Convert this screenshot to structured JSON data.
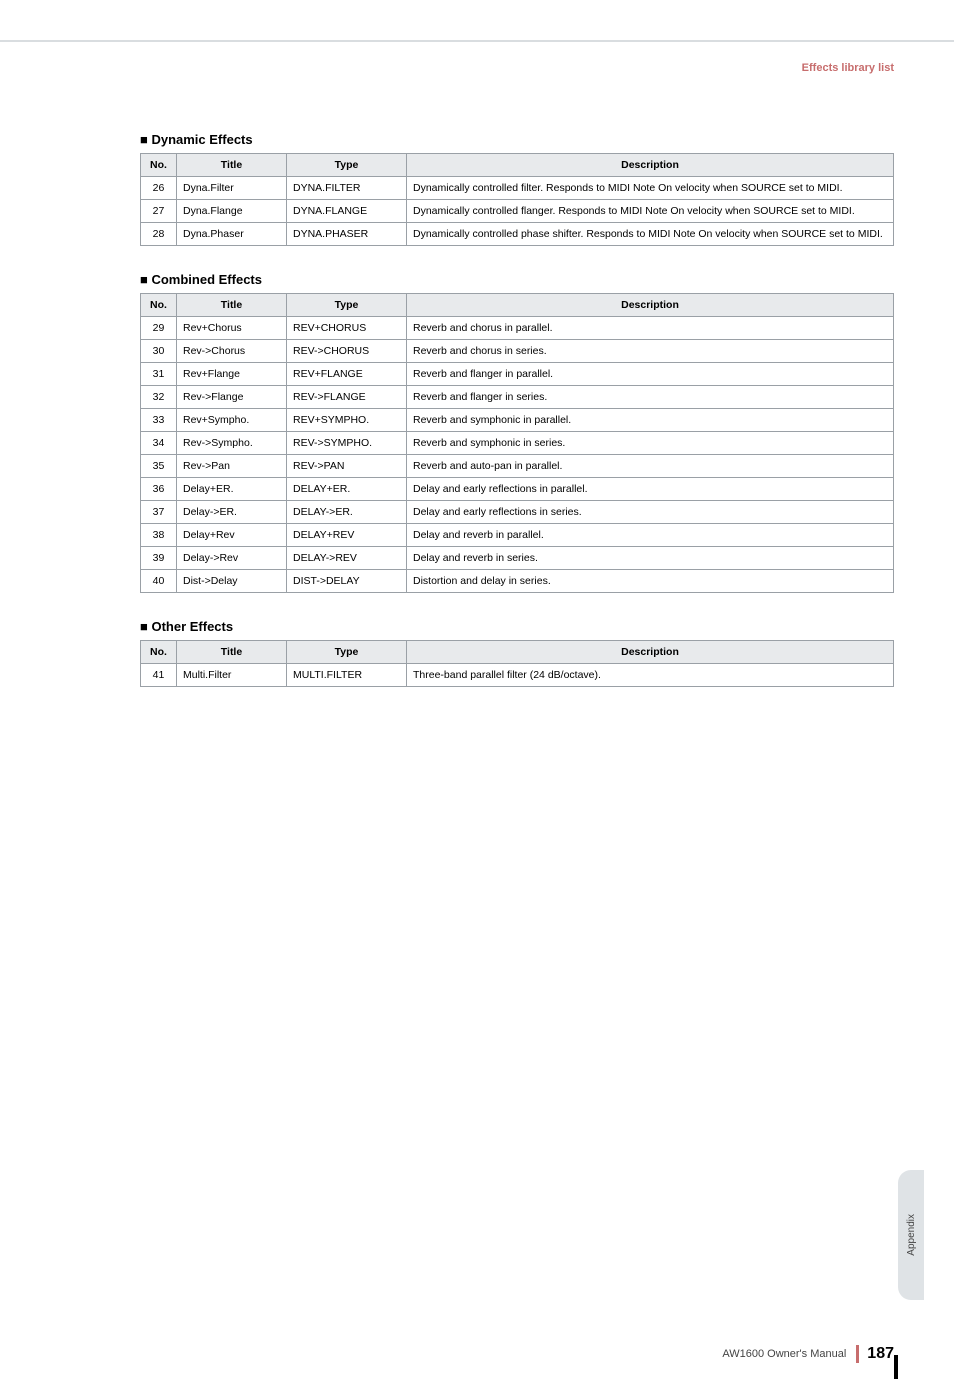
{
  "header_label": "Effects library list",
  "sections": [
    {
      "heading": "■ Dynamic Effects",
      "columns": [
        "No.",
        "Title",
        "Type",
        "Description"
      ],
      "rows": [
        {
          "no": "26",
          "title": "Dyna.Filter",
          "type": "DYNA.FILTER",
          "desc": "Dynamically controlled filter. Responds to MIDI Note On velocity when SOURCE set to MIDI."
        },
        {
          "no": "27",
          "title": "Dyna.Flange",
          "type": "DYNA.FLANGE",
          "desc": "Dynamically controlled flanger. Responds to MIDI Note On velocity when SOURCE set to MIDI."
        },
        {
          "no": "28",
          "title": "Dyna.Phaser",
          "type": "DYNA.PHASER",
          "desc": "Dynamically controlled phase shifter. Responds to MIDI Note On velocity when SOURCE set to MIDI."
        }
      ]
    },
    {
      "heading": "■ Combined Effects",
      "columns": [
        "No.",
        "Title",
        "Type",
        "Description"
      ],
      "rows": [
        {
          "no": "29",
          "title": "Rev+Chorus",
          "type": "REV+CHORUS",
          "desc": "Reverb and chorus in parallel."
        },
        {
          "no": "30",
          "title": "Rev->Chorus",
          "type": "REV->CHORUS",
          "desc": "Reverb and chorus in series."
        },
        {
          "no": "31",
          "title": "Rev+Flange",
          "type": "REV+FLANGE",
          "desc": "Reverb and flanger in parallel."
        },
        {
          "no": "32",
          "title": "Rev->Flange",
          "type": "REV->FLANGE",
          "desc": "Reverb and flanger in series."
        },
        {
          "no": "33",
          "title": "Rev+Sympho.",
          "type": "REV+SYMPHO.",
          "desc": "Reverb and symphonic in parallel."
        },
        {
          "no": "34",
          "title": "Rev->Sympho.",
          "type": "REV->SYMPHO.",
          "desc": "Reverb and symphonic in series."
        },
        {
          "no": "35",
          "title": "Rev->Pan",
          "type": "REV->PAN",
          "desc": "Reverb and auto-pan in parallel."
        },
        {
          "no": "36",
          "title": "Delay+ER.",
          "type": "DELAY+ER.",
          "desc": "Delay and early reflections in parallel."
        },
        {
          "no": "37",
          "title": "Delay->ER.",
          "type": "DELAY->ER.",
          "desc": "Delay and early reflections in series."
        },
        {
          "no": "38",
          "title": "Delay+Rev",
          "type": "DELAY+REV",
          "desc": "Delay and reverb in parallel."
        },
        {
          "no": "39",
          "title": "Delay->Rev",
          "type": "DELAY->REV",
          "desc": "Delay and reverb in series."
        },
        {
          "no": "40",
          "title": "Dist->Delay",
          "type": "DIST->DELAY",
          "desc": "Distortion and delay in series."
        }
      ]
    },
    {
      "heading": "■ Other Effects",
      "columns": [
        "No.",
        "Title",
        "Type",
        "Description"
      ],
      "rows": [
        {
          "no": "41",
          "title": "Multi.Filter",
          "type": "MULTI.FILTER",
          "desc": "Three-band parallel filter (24 dB/octave)."
        }
      ]
    }
  ],
  "side_tab": "Appendix",
  "footer_text": "AW1600  Owner's Manual",
  "page_number": "187"
}
